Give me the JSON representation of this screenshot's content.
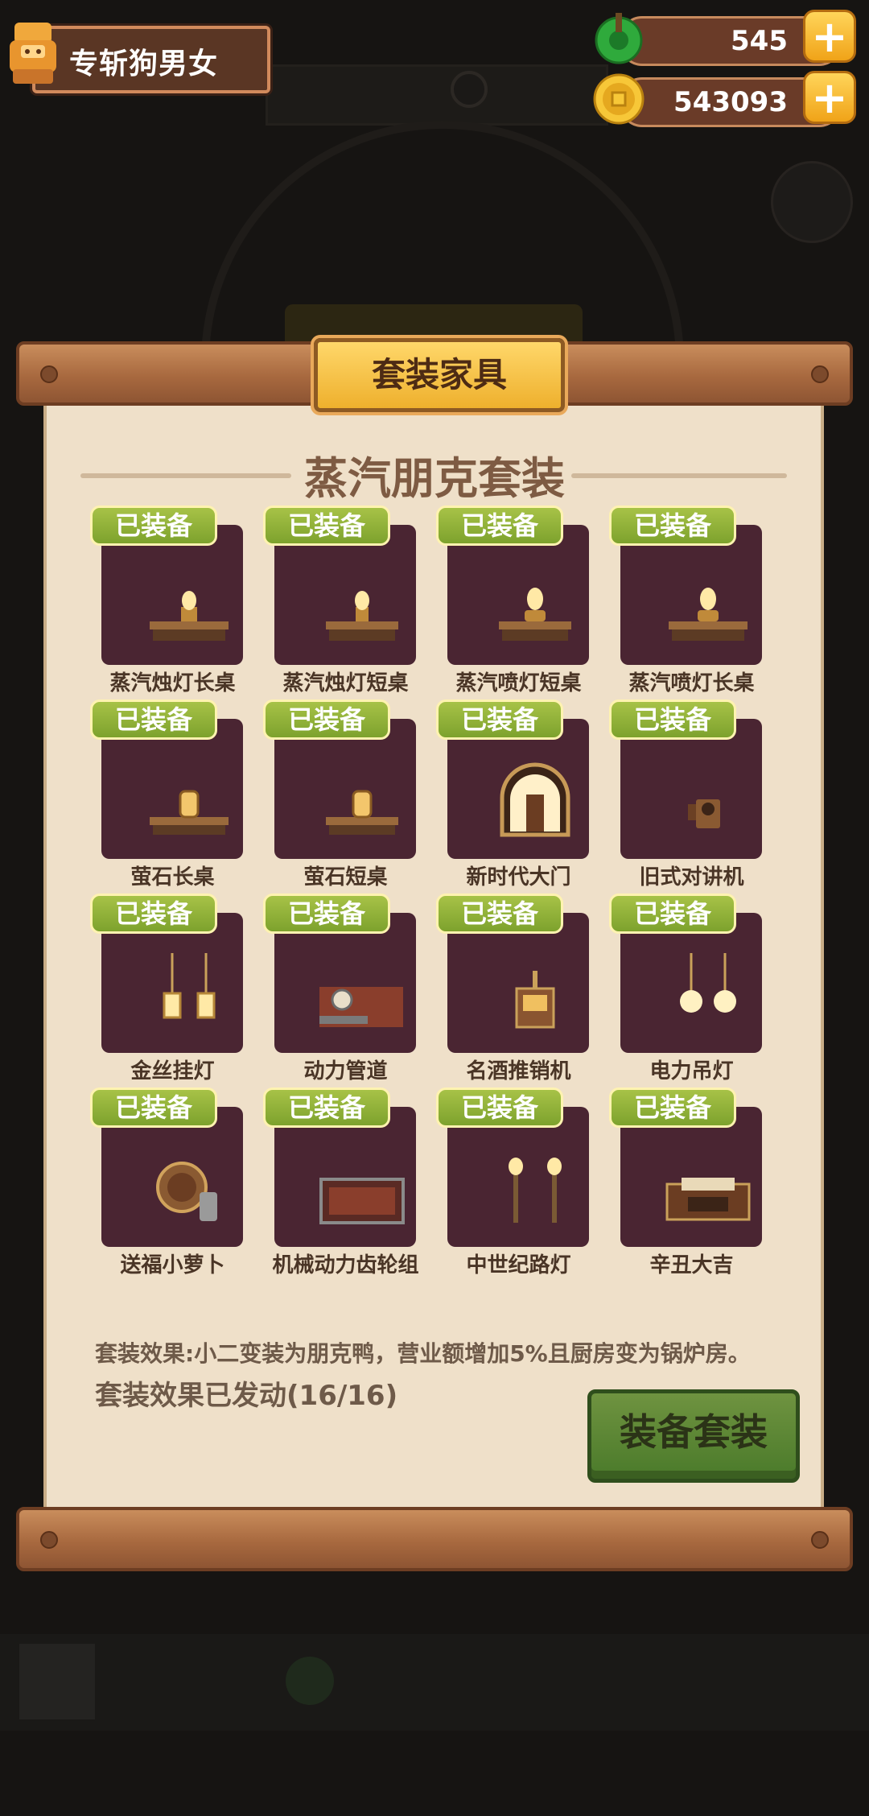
{
  "hud": {
    "player_name": "专斩狗男女",
    "jade_value": "545",
    "coin_value": "543093",
    "plus_label": "+"
  },
  "panel": {
    "tab_title": "套装家具",
    "set_name": "蒸汽朋克套装",
    "items": [
      {
        "badge": "已装备",
        "name": "蒸汽烛灯长桌",
        "icon": "candle-long-table-icon"
      },
      {
        "badge": "已装备",
        "name": "蒸汽烛灯短桌",
        "icon": "candle-short-table-icon"
      },
      {
        "badge": "已装备",
        "name": "蒸汽喷灯短桌",
        "icon": "blowlamp-short-table-icon"
      },
      {
        "badge": "已装备",
        "name": "蒸汽喷灯长桌",
        "icon": "blowlamp-long-table-icon"
      },
      {
        "badge": "已装备",
        "name": "萤石长桌",
        "icon": "fluorite-long-table-icon"
      },
      {
        "badge": "已装备",
        "name": "萤石短桌",
        "icon": "fluorite-short-table-icon"
      },
      {
        "badge": "已装备",
        "name": "新时代大门",
        "icon": "gate-icon"
      },
      {
        "badge": "已装备",
        "name": "旧式对讲机",
        "icon": "intercom-icon"
      },
      {
        "badge": "已装备",
        "name": "金丝挂灯",
        "icon": "hanging-lamps-icon"
      },
      {
        "badge": "已装备",
        "name": "动力管道",
        "icon": "power-pipe-icon"
      },
      {
        "badge": "已装备",
        "name": "名酒推销机",
        "icon": "wine-vending-icon"
      },
      {
        "badge": "已装备",
        "name": "电力吊灯",
        "icon": "pendant-lights-icon"
      },
      {
        "badge": "已装备",
        "name": "送福小萝卜",
        "icon": "fortune-robot-icon"
      },
      {
        "badge": "已装备",
        "name": "机械动力齿轮组",
        "icon": "gear-set-icon"
      },
      {
        "badge": "已装备",
        "name": "中世纪路灯",
        "icon": "street-lamps-icon"
      },
      {
        "badge": "已装备",
        "name": "辛丑大吉",
        "icon": "new-year-shop-icon"
      }
    ],
    "effect_description": "套装效果:小二变装为朋克鸭，营业额增加5%且厨房变为锅炉房。",
    "effect_status": "套装效果已发动(16/16)",
    "equip_button": "装备套装"
  },
  "colors": {
    "card_bg": "#4a2532",
    "badge_green": "#8fb138",
    "parchment": "#efe0c9",
    "tab_gold": "#f5c244",
    "button_green": "#5b8735"
  }
}
